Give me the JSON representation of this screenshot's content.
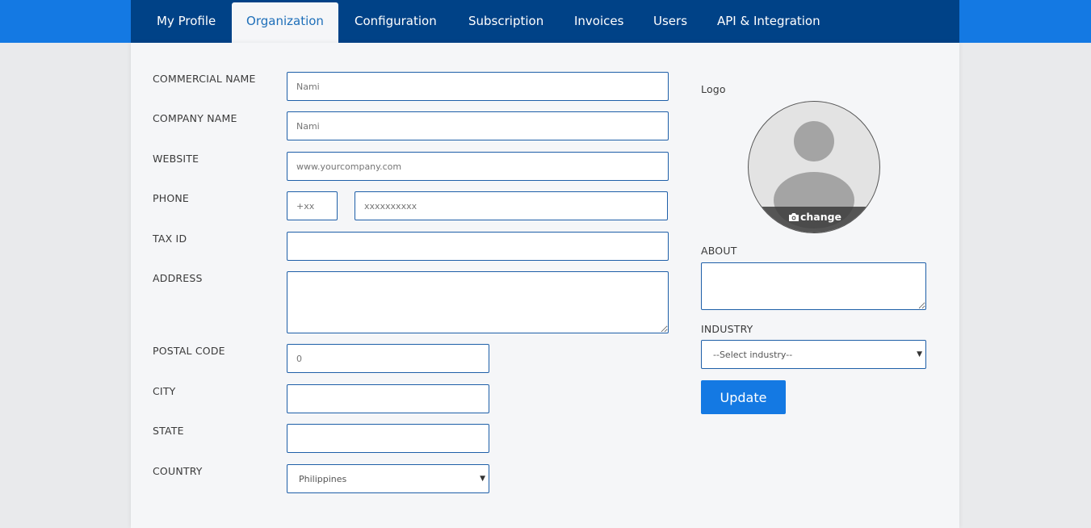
{
  "nav": {
    "tabs": [
      {
        "label": "My Profile"
      },
      {
        "label": "Organization",
        "active": true
      },
      {
        "label": "Configuration"
      },
      {
        "label": "Subscription"
      },
      {
        "label": "Invoices"
      },
      {
        "label": "Users"
      },
      {
        "label": "API & Integration"
      }
    ]
  },
  "form": {
    "commercial_name": {
      "label": "COMMERCIAL NAME",
      "value": "",
      "placeholder": "Nami"
    },
    "company_name": {
      "label": "COMPANY NAME",
      "value": "",
      "placeholder": "Nami"
    },
    "website": {
      "label": "WEBSITE",
      "value": "",
      "placeholder": "www.yourcompany.com"
    },
    "phone": {
      "label": "PHONE",
      "code_placeholder": "+xx",
      "number_placeholder": "xxxxxxxxxx"
    },
    "tax_id": {
      "label": "TAX ID",
      "value": ""
    },
    "address": {
      "label": "ADDRESS",
      "value": ""
    },
    "postal_code": {
      "label": "POSTAL CODE",
      "value": "",
      "placeholder": "0"
    },
    "city": {
      "label": "CITY",
      "value": ""
    },
    "state": {
      "label": "STATE",
      "value": ""
    },
    "country": {
      "label": "COUNTRY",
      "selected": "Philippines"
    }
  },
  "side": {
    "logo_label": "Logo",
    "change_label": "change",
    "about_label": "ABOUT",
    "industry_label": "INDUSTRY",
    "industry_selected": "--Select industry--",
    "update_label": "Update"
  },
  "colors": {
    "top_band": "#1479e3",
    "nav_background": "#004287",
    "active_tab_text": "#1e6fb9",
    "field_border": "#1e5fa8",
    "button": "#1479e3"
  },
  "icons": [
    "camera-icon",
    "chevron-down-icon",
    "avatar-placeholder-icon"
  ]
}
